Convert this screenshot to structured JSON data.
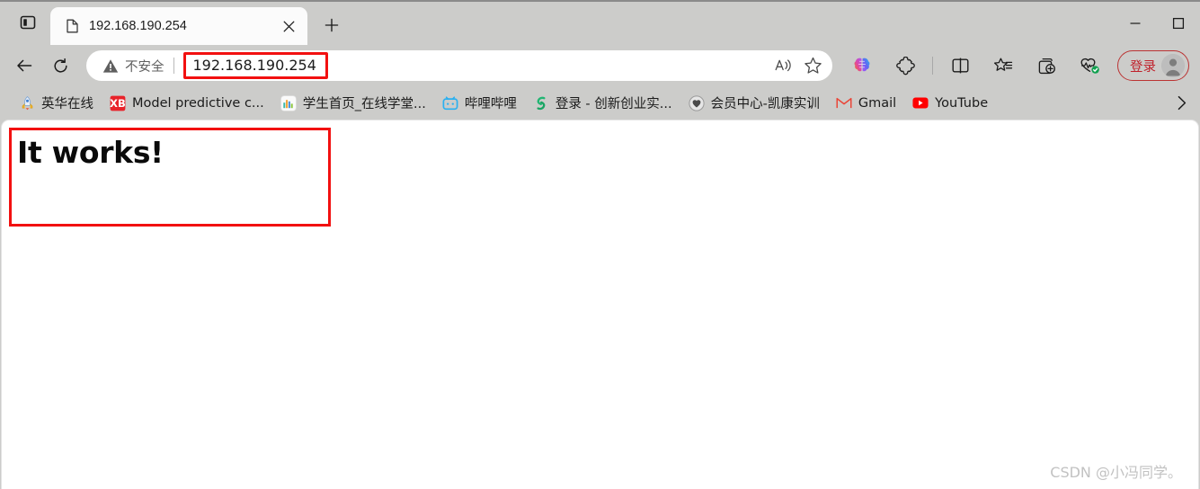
{
  "window": {
    "minimize_label": "Minimize",
    "maximize_label": "Maximize"
  },
  "tabstrip": {
    "tab_actions_label": "Tab actions menu",
    "new_tab_label": "New tab",
    "tabs": [
      {
        "title": "192.168.190.254",
        "favicon": "document-icon",
        "close_label": "Close tab"
      }
    ]
  },
  "navbar": {
    "back_label": "Back",
    "refresh_label": "Refresh",
    "omnibox": {
      "security_text": "不安全",
      "security_icon": "warning-triangle-icon",
      "url": "192.168.190.254",
      "url_highlight_color": "#f21010",
      "read_aloud_label": "Read aloud",
      "favorite_label": "Add this page to favorites"
    },
    "icons": [
      {
        "name": "copilot-icon",
        "label": "Copilot"
      },
      {
        "name": "extensions-icon",
        "label": "Extensions"
      },
      {
        "name": "split-screen-icon",
        "label": "Split screen"
      },
      {
        "name": "favorites-icon",
        "label": "Favorites"
      },
      {
        "name": "collections-icon",
        "label": "Collections"
      },
      {
        "name": "browser-essentials-icon",
        "label": "Browser essentials"
      }
    ],
    "signin": {
      "label": "登录",
      "text_color": "#c0202a",
      "border_color": "#b33333"
    }
  },
  "bookmarks": {
    "overflow_label": "Show more bookmarks",
    "items": [
      {
        "label": "英华在线",
        "favicon": "rocket-icon"
      },
      {
        "label": "Model predictive c...",
        "favicon": "xb-icon"
      },
      {
        "label": "学生首页_在线学堂...",
        "favicon": "barchart-icon"
      },
      {
        "label": "哔哩哔哩",
        "favicon": "bilibili-icon"
      },
      {
        "label": "登录 - 创新创业实...",
        "favicon": "green-s-icon"
      },
      {
        "label": "会员中心-凯康实训",
        "favicon": "heart-circle-icon"
      },
      {
        "label": "Gmail",
        "favicon": "gmail-icon"
      },
      {
        "label": "YouTube",
        "favicon": "youtube-icon"
      }
    ]
  },
  "page": {
    "heading": "It works!",
    "annotation_color": "#f21010",
    "watermark": "CSDN @小冯同学。"
  }
}
